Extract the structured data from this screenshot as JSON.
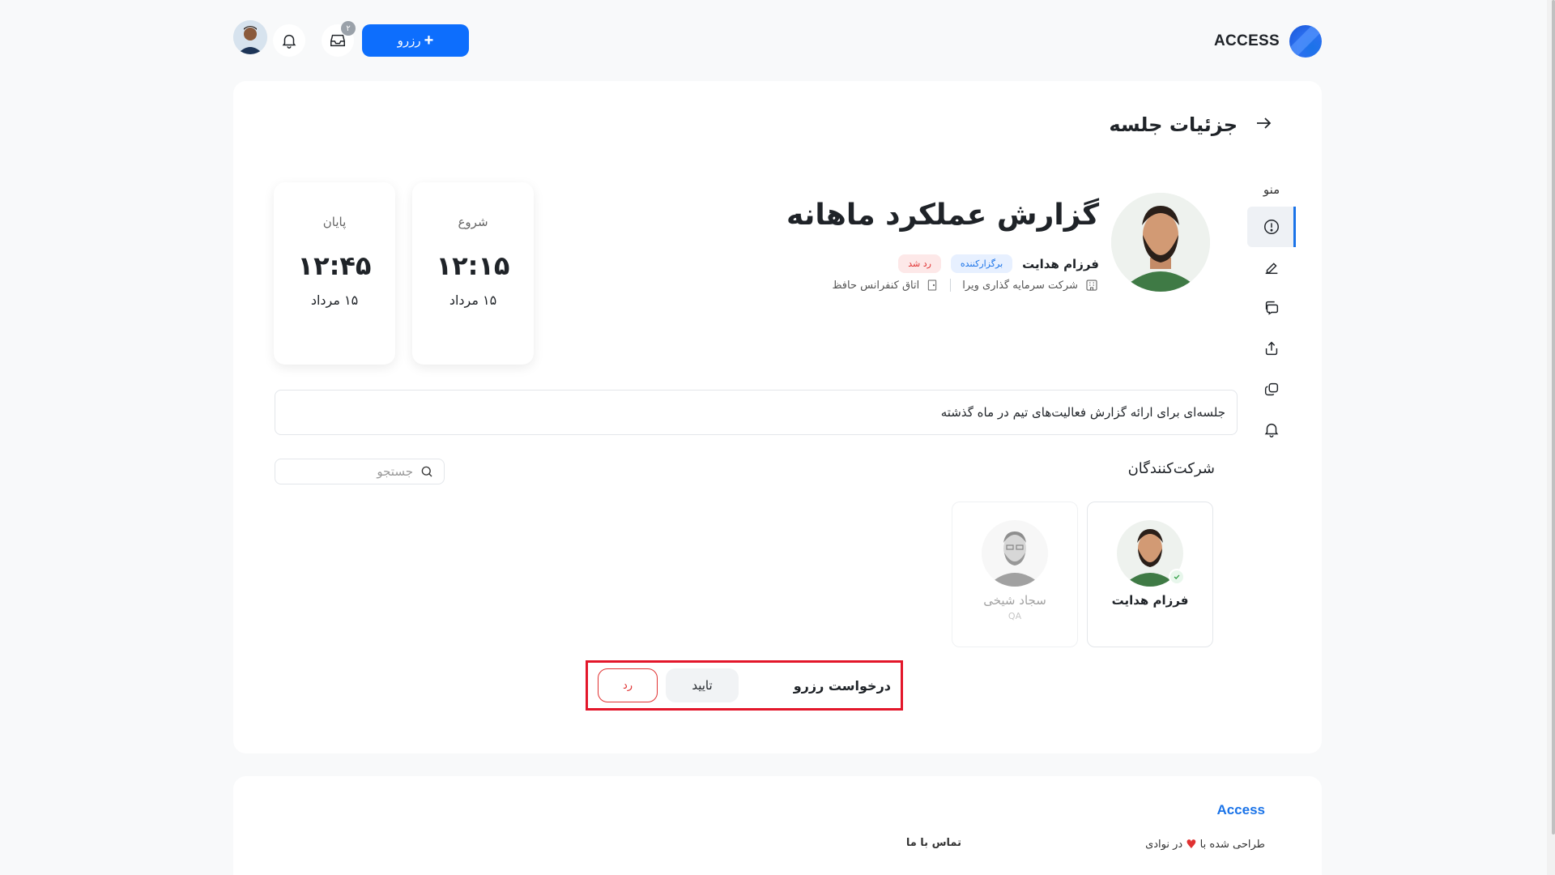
{
  "topbar": {
    "brand": "ACCESS",
    "reserve_label": "رزرو",
    "inbox_count": "۲"
  },
  "page": {
    "title": "جزئیات جلسه"
  },
  "sidenav": {
    "title": "منو",
    "items": [
      {
        "icon": "info-icon",
        "active": true
      },
      {
        "icon": "edit-icon",
        "active": false
      },
      {
        "icon": "chat-icon",
        "active": false
      },
      {
        "icon": "share-icon",
        "active": false
      },
      {
        "icon": "copy-icon",
        "active": false
      },
      {
        "icon": "bell-icon",
        "active": false
      }
    ]
  },
  "meeting": {
    "title": "گزارش عملکرد ماهانه",
    "host_name": "فرزام هدایت",
    "host_tag": "برگزارکننده",
    "status_tag": "رد شد",
    "company": "شرکت سرمایه گذاری ویرا",
    "room": "اتاق کنفرانس حافظ",
    "description": "جلسه‌ای برای ارائه گزارش فعالیت‌های تیم در ماه گذشته",
    "start": {
      "label": "شروع",
      "time": "۱۲:۱۵",
      "date": "۱۵ مرداد"
    },
    "end": {
      "label": "پایان",
      "time": "۱۲:۴۵",
      "date": "۱۵ مرداد"
    }
  },
  "participants": {
    "title": "شرکت‌کنندگان",
    "search_placeholder": "جستجو",
    "list": [
      {
        "name": "فرزام هدایت",
        "role": "",
        "confirmed": true
      },
      {
        "name": "سجاد شیخی",
        "role": "QA",
        "confirmed": false
      }
    ]
  },
  "request": {
    "label": "درخواست رزرو",
    "approve": "تایید",
    "reject": "رد"
  },
  "footer": {
    "brand": "Access",
    "made_prefix": "طراحی شده با",
    "made_suffix": "در نوادی",
    "contact": "تماس با ما"
  },
  "colors": {
    "primary": "#0d6efd",
    "danger": "#e03131",
    "highlight_border": "#e3162a"
  }
}
